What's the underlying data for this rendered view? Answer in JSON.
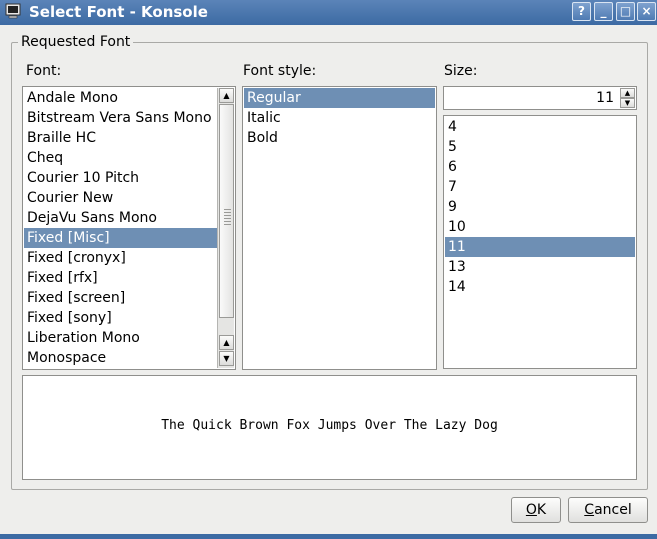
{
  "window": {
    "title": "Select Font - Konsole",
    "icon": "terminal-icon",
    "help_label": "?",
    "minimize_label": "_",
    "maximize_label": "□",
    "close_label": "×",
    "accent": "#3c6aa3"
  },
  "group": {
    "title": "Requested Font"
  },
  "font_list": {
    "label": "Font:",
    "items": [
      "Andale Mono",
      "Bitstream Vera Sans Mono",
      "Braille HC",
      "Cheq",
      "Courier 10 Pitch",
      "Courier New",
      "DejaVu Sans Mono",
      "Fixed [Misc]",
      "Fixed [cronyx]",
      "Fixed [rfx]",
      "Fixed [screen]",
      "Fixed [sony]",
      "Liberation Mono",
      "Monospace"
    ],
    "selected": "Fixed [Misc]",
    "scroll_up_icon": "▲",
    "scroll_down_icon": "▼"
  },
  "style_list": {
    "label": "Font style:",
    "items": [
      "Regular",
      "Italic",
      "Bold"
    ],
    "selected": "Regular"
  },
  "size": {
    "label": "Size:",
    "value": "11",
    "items": [
      "4",
      "5",
      "6",
      "7",
      "9",
      "10",
      "11",
      "13",
      "14"
    ],
    "selected": "11"
  },
  "preview": {
    "text": "The Quick Brown Fox Jumps Over The Lazy Dog"
  },
  "buttons": {
    "ok": {
      "mnemonic": "O",
      "rest": "K"
    },
    "cancel": {
      "mnemonic": "C",
      "rest": "ancel"
    }
  },
  "colors": {
    "selection": "#6e8fb4",
    "titlebar": "#3c6aa3"
  }
}
